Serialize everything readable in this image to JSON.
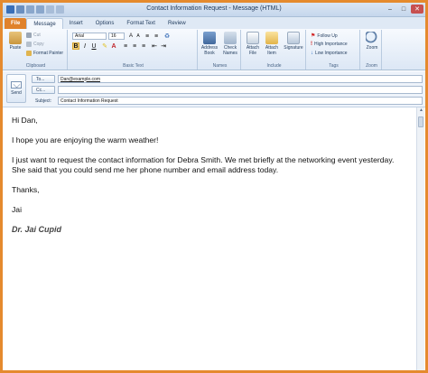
{
  "window": {
    "title": "Contact Information Request - Message (HTML)",
    "min": "–",
    "max": "□",
    "close": "✕"
  },
  "tabs": [
    "File",
    "Message",
    "Insert",
    "Options",
    "Format Text",
    "Review"
  ],
  "ribbon": {
    "clipboard": {
      "paste": "Paste",
      "cut": "Cut",
      "copy": "Copy",
      "format_painter": "Format Painter",
      "label": "Clipboard"
    },
    "basic_text": {
      "font": "Arial",
      "size": "16",
      "bold": "B",
      "italic": "I",
      "underline": "U",
      "label": "Basic Text"
    },
    "names": {
      "address_book": "Address Book",
      "check_names": "Check Names",
      "label": "Names"
    },
    "include": {
      "attach_file": "Attach File",
      "attach_item": "Attach Item",
      "signature": "Signature",
      "label": "Include"
    },
    "tags": {
      "follow_up": "Follow Up",
      "high_importance": "High Importance",
      "low_importance": "Low Importance",
      "label": "Tags"
    },
    "zoom": {
      "zoom": "Zoom",
      "label": "Zoom"
    }
  },
  "header": {
    "send": "Send",
    "to_label": "To...",
    "to_value": "Dan@example.com",
    "cc_label": "Cc...",
    "cc_value": "",
    "subject_label": "Subject:",
    "subject_value": "Contact Information Request"
  },
  "message": {
    "greeting": "Hi Dan,",
    "line1": "I hope you are enjoying the warm weather!",
    "line2": "I just want to request the contact information for Debra Smith.  We met briefly at the networking event yesterday.  She said that you could send me her phone number and email address today.",
    "closing": "Thanks,",
    "name": "Jai",
    "signature": "Dr. Jai Cupid"
  },
  "colors": {
    "file_tab": "#e0822b",
    "frame": "#e58a2e",
    "ribbon": "#dce7f5"
  }
}
